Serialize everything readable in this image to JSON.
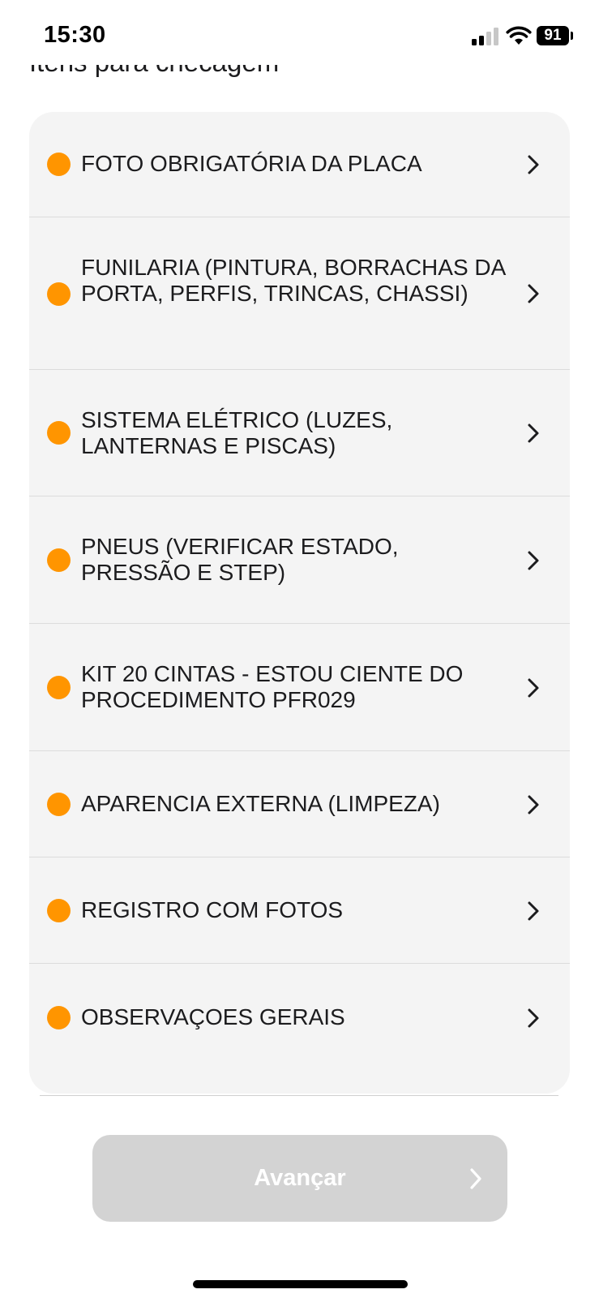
{
  "status_bar": {
    "time": "15:30",
    "battery": "91",
    "icons": [
      "signal-icon",
      "wifi-icon",
      "battery-icon"
    ]
  },
  "section": {
    "heading": "Itens para checagem"
  },
  "checklist": {
    "status_color": "#ff9500",
    "items": [
      {
        "label": "FOTO OBRIGATÓRIA DA PLACA"
      },
      {
        "label": "FUNILARIA (PINTURA, BORRACHAS DA PORTA, PERFIS, TRINCAS, CHASSI)"
      },
      {
        "label": "SISTEMA ELÉTRICO (LUZES, LANTERNAS E PISCAS)"
      },
      {
        "label": "PNEUS (VERIFICAR ESTADO, PRESSÃO E STEP)"
      },
      {
        "label": "KIT 20 CINTAS - ESTOU CIENTE DO PROCEDIMENTO PFR029"
      },
      {
        "label": "APARENCIA EXTERNA (LIMPEZA)"
      },
      {
        "label": "REGISTRO COM FOTOS"
      },
      {
        "label": "OBSERVAÇOES GERAIS"
      }
    ]
  },
  "footer": {
    "next_label": "Avançar",
    "next_icon": "chevron-right-icon"
  }
}
